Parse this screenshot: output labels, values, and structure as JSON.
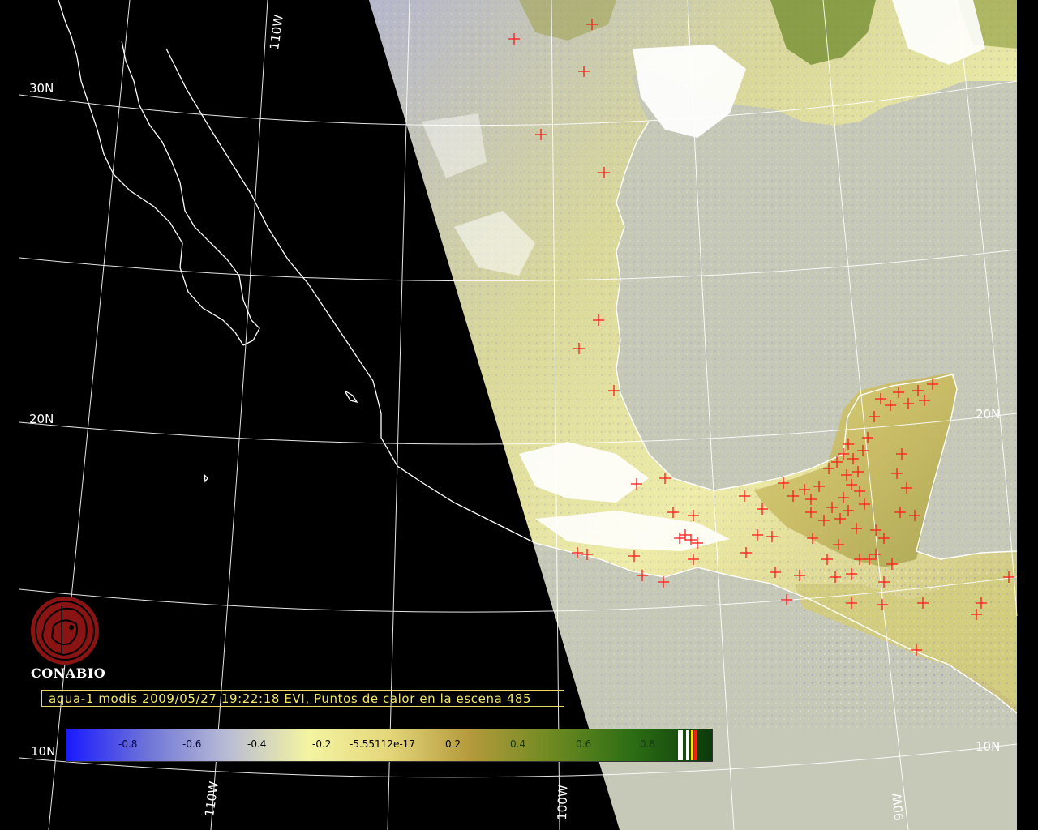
{
  "map": {
    "grid_labels": {
      "lat_30": "30N",
      "lat_20": "20N",
      "lat_10": "10N",
      "lat_20_right": "20N",
      "lat_10_right": "10N",
      "lon_110_top": "110W",
      "lon_110_bottom": "110W",
      "lon_100_bottom": "100W",
      "lon_90_bottom": "90W"
    },
    "colors": {
      "background": "#000000",
      "ocean": "#c6c8b8",
      "coastline": "#ffffff",
      "graticule": "#ffffff",
      "hotspot": "#ff1a1a"
    }
  },
  "logo": {
    "name": "CONABIO",
    "color": "#8a1414"
  },
  "caption": {
    "text": "aqua-1 modis 2009/05/27 19:22:18 EVI, Puntos de calor en la escena 485"
  },
  "colorbar": {
    "ticks": [
      "-0.8",
      "-0.6",
      "-0.4",
      "-0.2",
      "-5.55112e-17",
      "0.2",
      "0.4",
      "0.6",
      "0.8"
    ],
    "colors": [
      "#1a1aff",
      "#6e74d8",
      "#b9bcd4",
      "#f4f4a2",
      "#e4d67a",
      "#b49a3c",
      "#6f8a22",
      "#2d6e14",
      "#0b3a0b"
    ]
  }
}
